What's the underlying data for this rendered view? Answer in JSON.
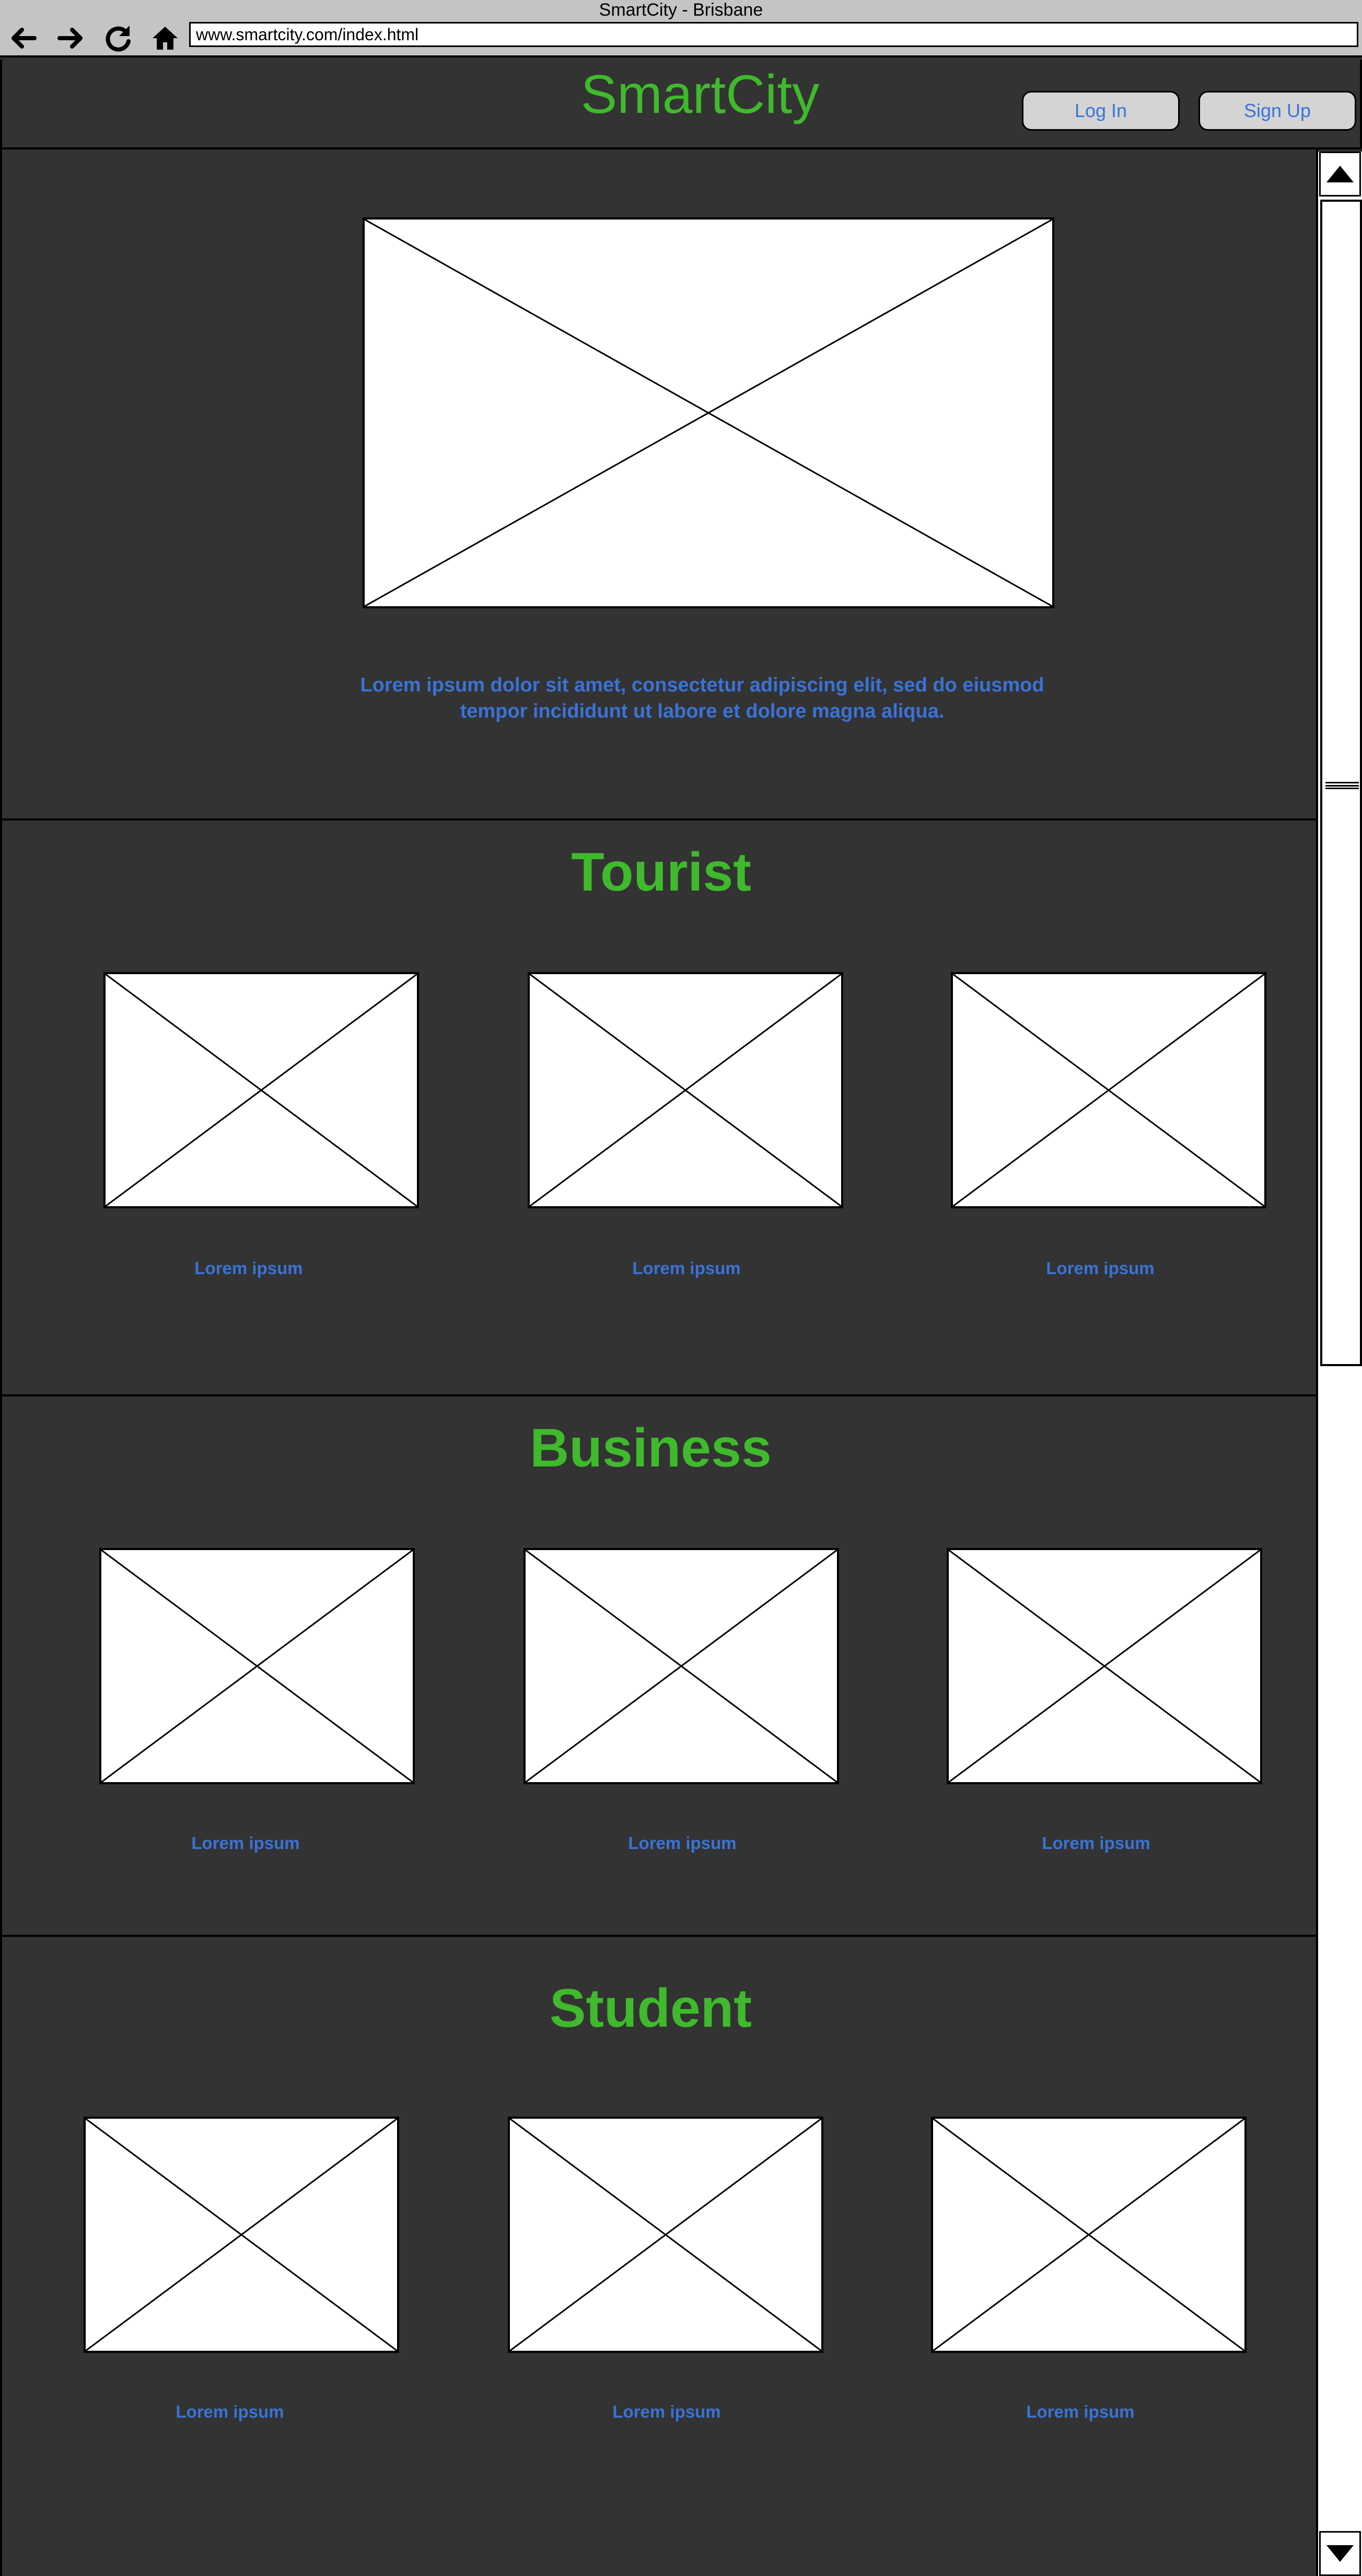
{
  "browser": {
    "window_title": "SmartCity - Brisbane",
    "url": "www.smartcity.com/index.html"
  },
  "header": {
    "site_title": "SmartCity",
    "login_label": "Log In",
    "signup_label": "Sign Up"
  },
  "hero": {
    "text": "Lorem ipsum dolor sit amet, consectetur adipiscing elit, sed do eiusmod tempor incididunt ut labore et dolore magna aliqua."
  },
  "sections": [
    {
      "title": "Tourist",
      "cards": [
        {
          "caption": "Lorem ipsum"
        },
        {
          "caption": "Lorem ipsum"
        },
        {
          "caption": "Lorem ipsum"
        }
      ]
    },
    {
      "title": "Business",
      "cards": [
        {
          "caption": "Lorem ipsum"
        },
        {
          "caption": "Lorem ipsum"
        },
        {
          "caption": "Lorem ipsum"
        }
      ]
    },
    {
      "title": "Student",
      "cards": [
        {
          "caption": "Lorem ipsum"
        },
        {
          "caption": "Lorem ipsum"
        },
        {
          "caption": "Lorem ipsum"
        }
      ]
    }
  ],
  "colors": {
    "background": "#333333",
    "title_green": "#3fba2c",
    "link_blue": "#3a73d6",
    "chrome_gray": "#c4c4c4"
  },
  "icons": {
    "back": "back-arrow-icon",
    "forward": "forward-arrow-icon",
    "reload": "reload-icon",
    "home": "home-icon",
    "scroll_up": "scroll-up-arrow-icon",
    "scroll_down": "scroll-down-arrow-icon",
    "image_placeholder": "image-placeholder-icon"
  }
}
